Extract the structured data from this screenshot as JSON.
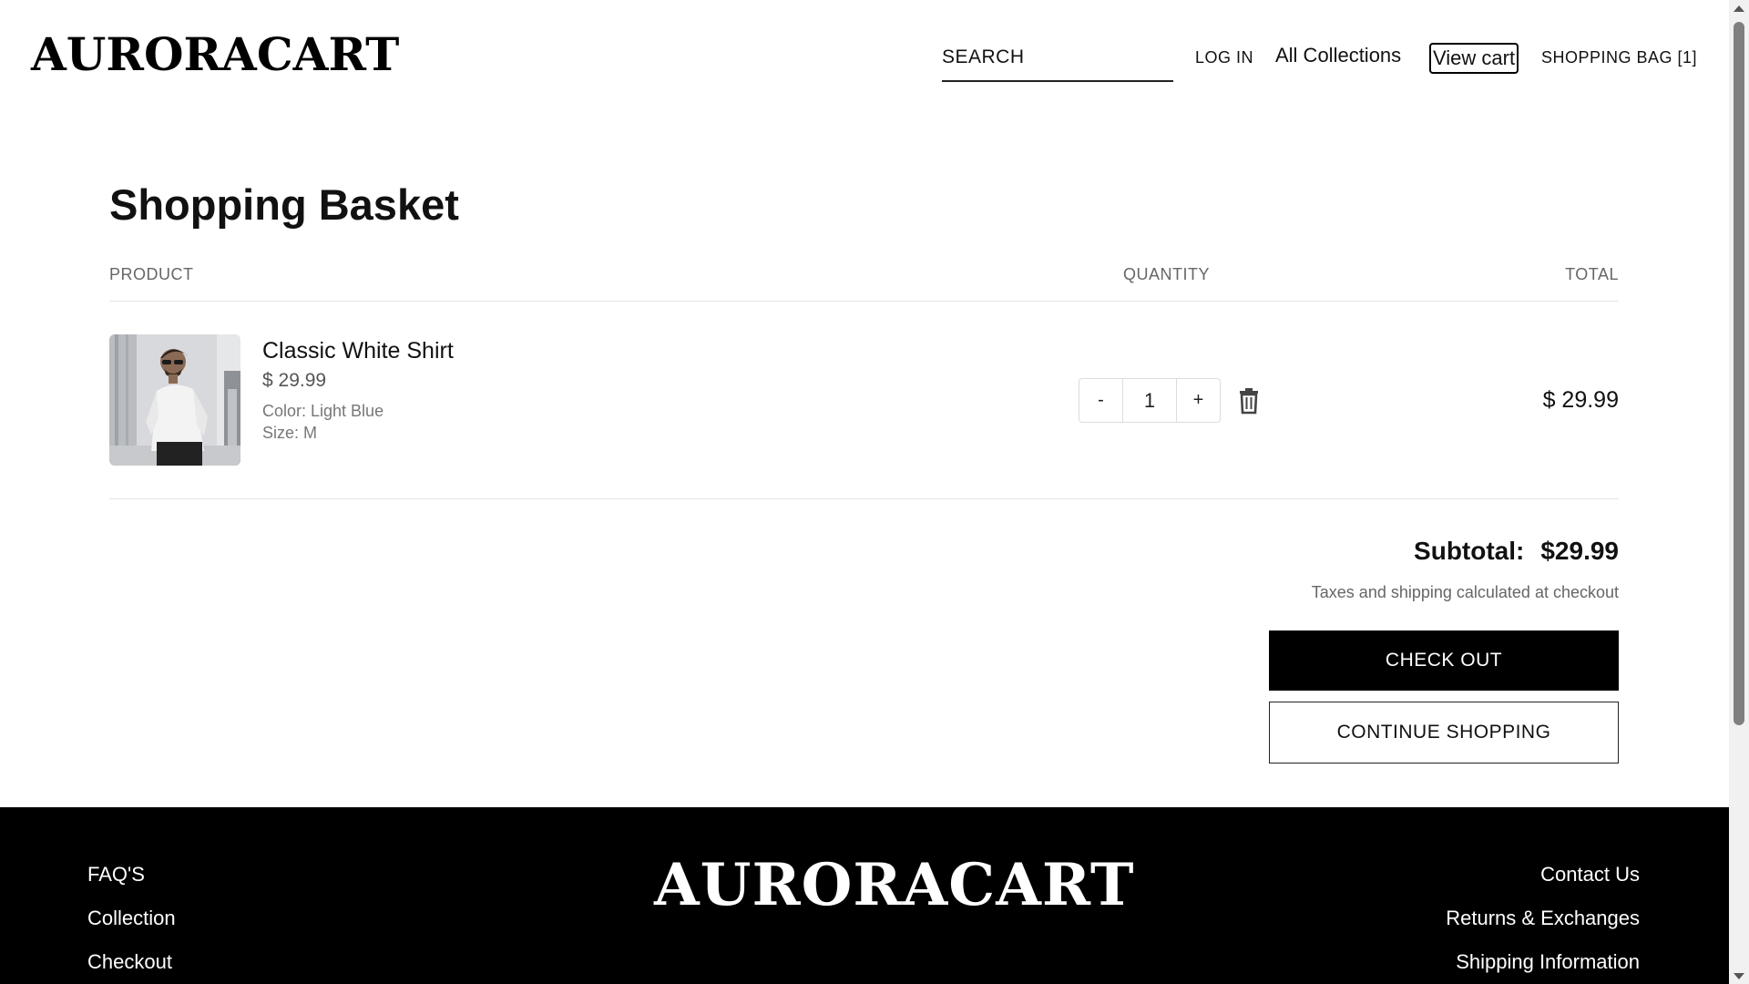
{
  "header": {
    "logo": "AURORACART",
    "search_placeholder": "SEARCH",
    "nav": {
      "login": "LOG IN",
      "collections": "All Collections",
      "view_cart": "View cart",
      "shopping_bag": "SHOPPING BAG [1]"
    }
  },
  "basket": {
    "title": "Shopping Basket",
    "columns": {
      "product": "PRODUCT",
      "quantity": "QUANTITY",
      "total": "TOTAL"
    },
    "items": [
      {
        "name": "Classic White Shirt",
        "price": "$ 29.99",
        "color": "Color: Light Blue",
        "size": "Size: M",
        "quantity": "1",
        "decrement": "-",
        "increment": "+",
        "total": "$ 29.99",
        "image_icon": "product-photo-white-shirt"
      }
    ],
    "subtotal_label": "Subtotal:",
    "subtotal_value": "$29.99",
    "tax_note": "Taxes and shipping calculated at checkout",
    "checkout_label": "CHECK OUT",
    "continue_label": "CONTINUE SHOPPING"
  },
  "footer": {
    "logo": "AURORACART",
    "left_links": [
      "FAQ'S",
      "Collection",
      "Checkout"
    ],
    "right_links": [
      "Contact Us",
      "Returns & Exchanges",
      "Shipping Information"
    ]
  },
  "colors": {
    "primary": "#000000",
    "background": "#ffffff",
    "muted_text": "#666666",
    "divider": "#e3e3e3"
  }
}
